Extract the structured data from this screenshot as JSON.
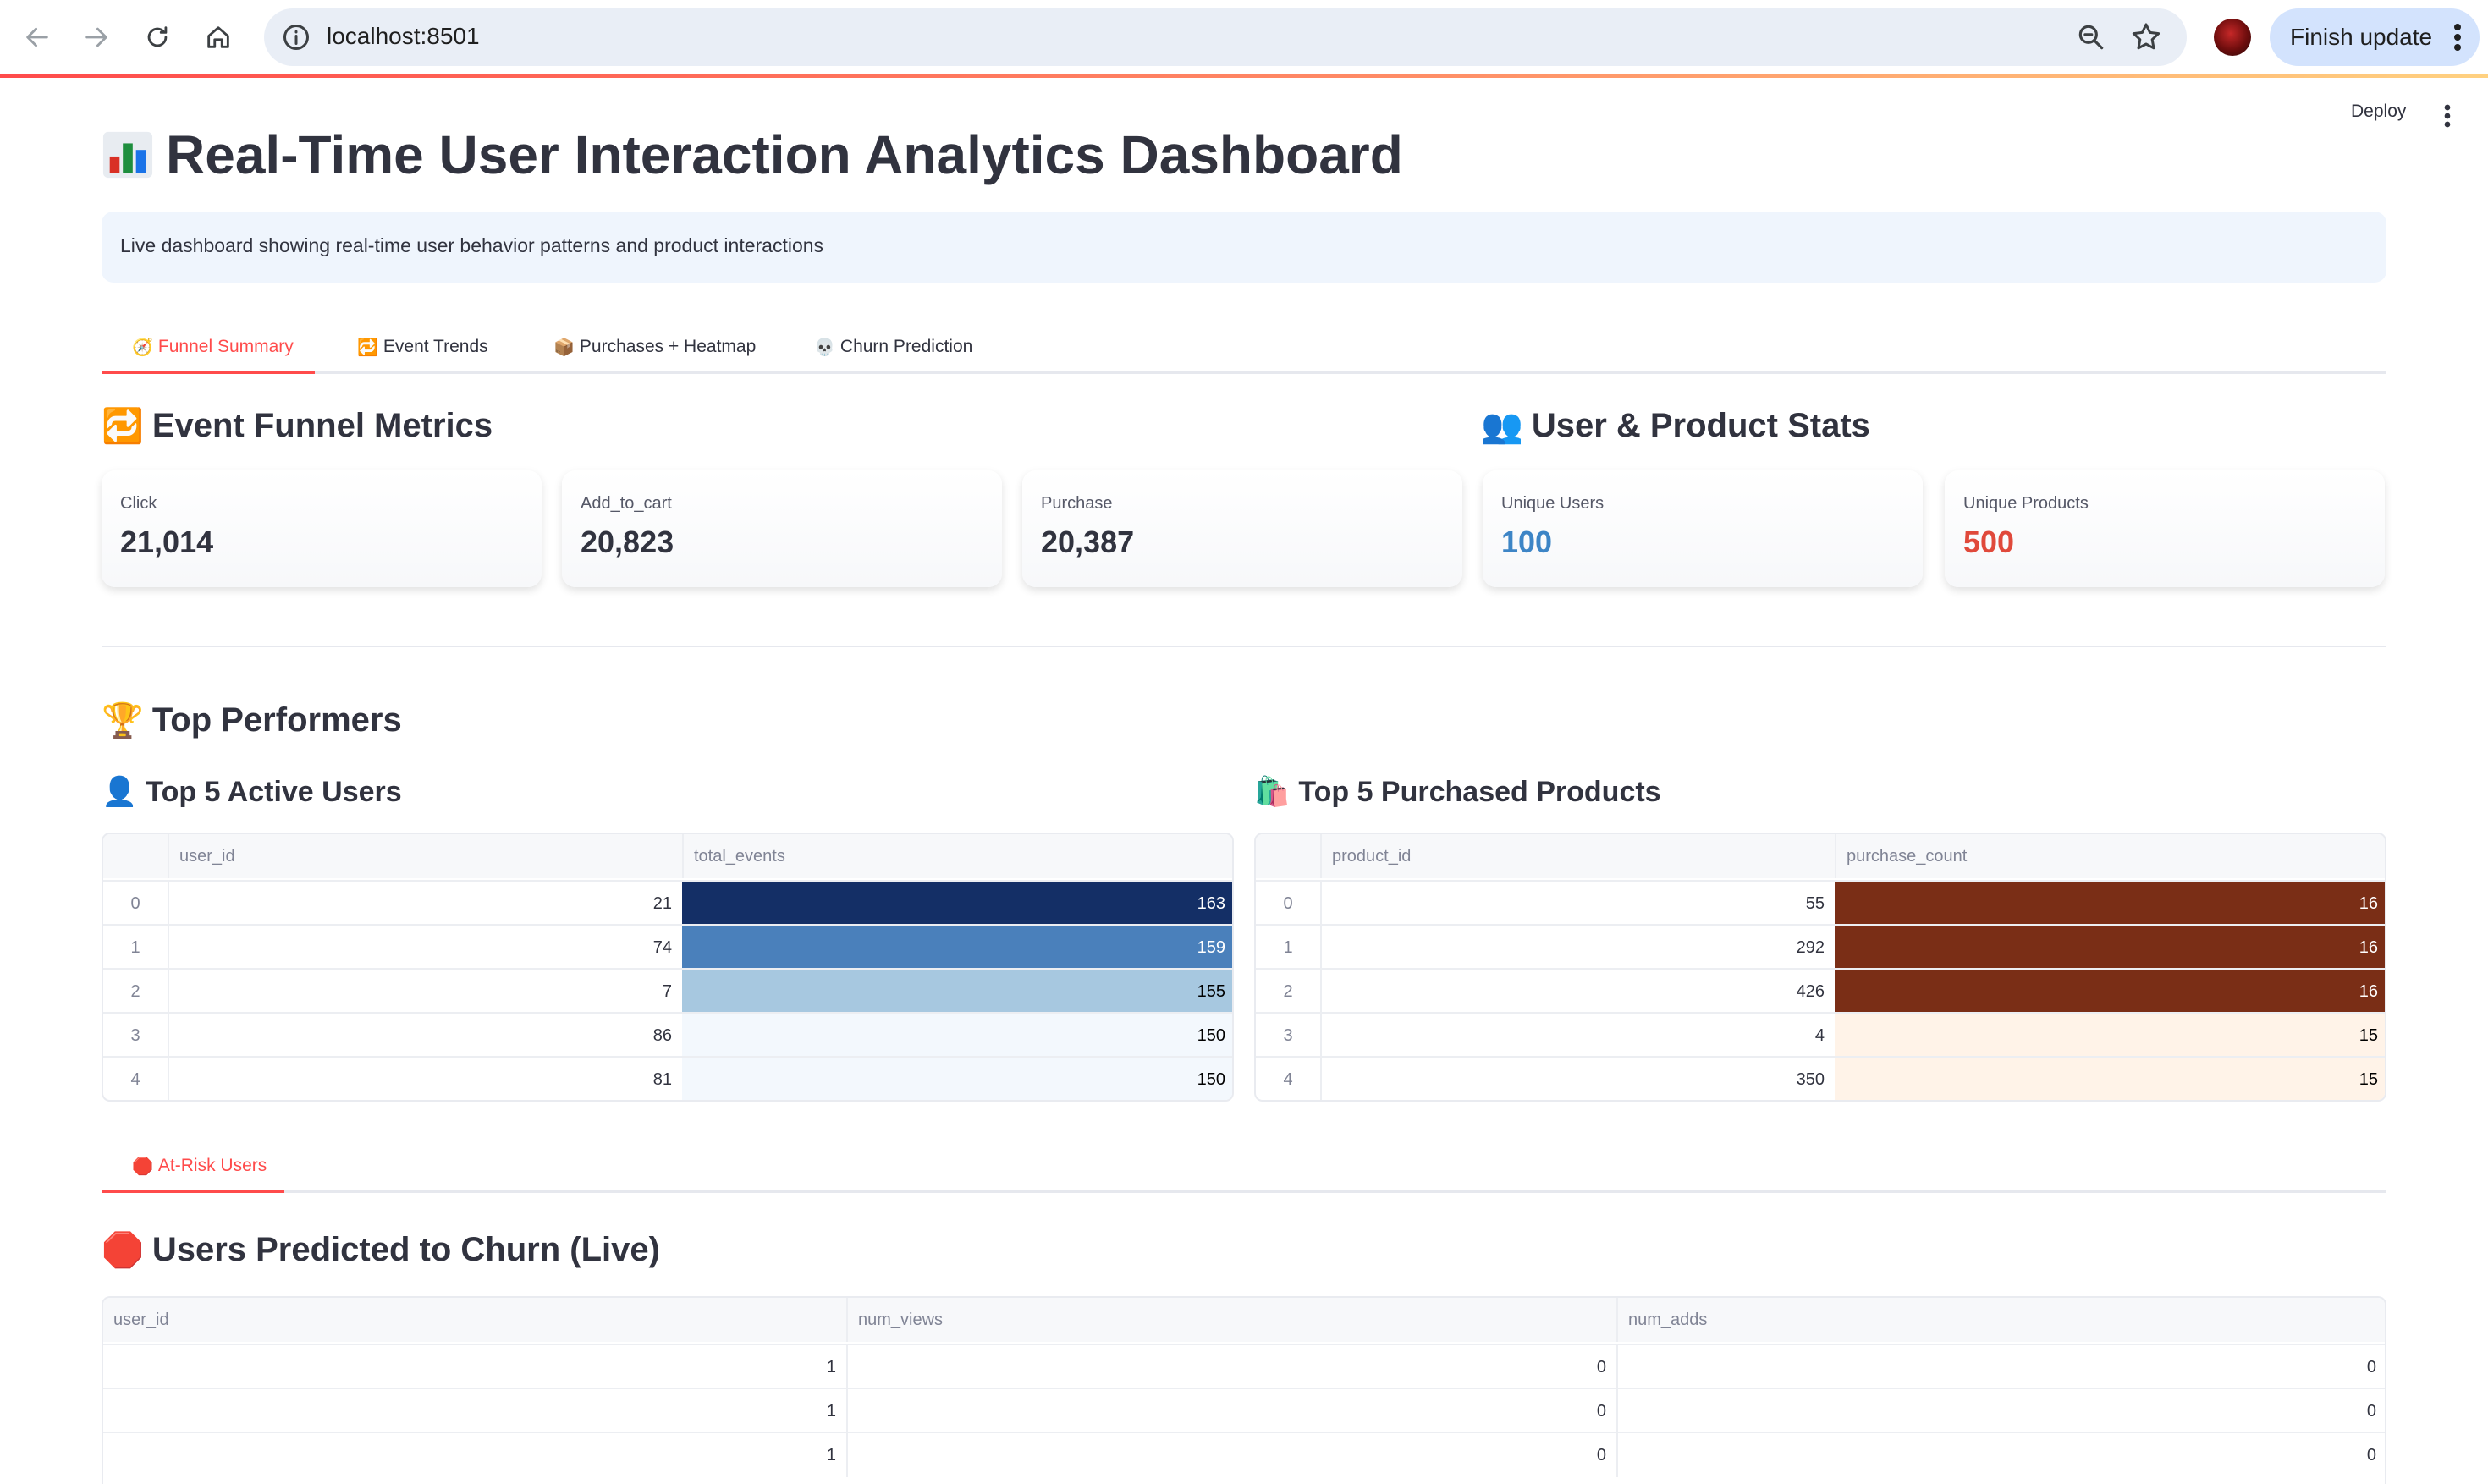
{
  "browser": {
    "url": "localhost:8501",
    "finish_update_label": "Finish update"
  },
  "header": {
    "deploy_label": "Deploy"
  },
  "page": {
    "title": "Real-Time User Interaction Analytics Dashboard",
    "info": "Live dashboard showing real-time user behavior patterns and product interactions"
  },
  "tabs": [
    {
      "label": "Funnel Summary",
      "icon": "compass-icon",
      "active": true
    },
    {
      "label": "Event Trends",
      "icon": "repeat-icon",
      "active": false
    },
    {
      "label": "Purchases + Heatmap",
      "icon": "package-icon",
      "active": false
    },
    {
      "label": "Churn Prediction",
      "icon": "skull-icon",
      "active": false
    }
  ],
  "funnel": {
    "heading": "Event Funnel Metrics",
    "metrics": [
      {
        "label": "Click",
        "value": "21,014"
      },
      {
        "label": "Add_to_cart",
        "value": "20,823"
      },
      {
        "label": "Purchase",
        "value": "20,387"
      }
    ]
  },
  "stats": {
    "heading": "User & Product Stats",
    "metrics": [
      {
        "label": "Unique Users",
        "value": "100",
        "color": "#3d85c6"
      },
      {
        "label": "Unique Products",
        "value": "500",
        "color": "#e0493b"
      }
    ]
  },
  "top_performers": {
    "heading": "Top Performers",
    "users": {
      "heading": "Top 5 Active Users",
      "columns": [
        "",
        "user_id",
        "total_events"
      ],
      "rows": [
        [
          "0",
          "21",
          "163"
        ],
        [
          "1",
          "74",
          "159"
        ],
        [
          "2",
          "7",
          "155"
        ],
        [
          "3",
          "86",
          "150"
        ],
        [
          "4",
          "81",
          "150"
        ]
      ],
      "cell_colors": [
        "#142f66",
        "#4a80bb",
        "#a7c8e0",
        "#f3f8fd",
        "#f3f8fd"
      ],
      "cell_text_colors": [
        "#ffffff",
        "#ffffff",
        "#000000",
        "#000000",
        "#000000"
      ]
    },
    "products": {
      "heading": "Top 5 Purchased Products",
      "columns": [
        "",
        "product_id",
        "purchase_count"
      ],
      "rows": [
        [
          "0",
          "55",
          "16"
        ],
        [
          "1",
          "292",
          "16"
        ],
        [
          "2",
          "426",
          "16"
        ],
        [
          "3",
          "4",
          "15"
        ],
        [
          "4",
          "350",
          "15"
        ]
      ],
      "cell_colors": [
        "#7a2e16",
        "#7a2e16",
        "#7a2e16",
        "#fff3e8",
        "#fff3e8"
      ],
      "cell_text_colors": [
        "#ffffff",
        "#ffffff",
        "#ffffff",
        "#000000",
        "#000000"
      ]
    }
  },
  "churn_tab": {
    "label": "At-Risk Users"
  },
  "churn": {
    "heading": "Users Predicted to Churn (Live)",
    "columns": [
      "user_id",
      "num_views",
      "num_adds"
    ],
    "rows": [
      [
        "1",
        "0",
        "0"
      ],
      [
        "1",
        "0",
        "0"
      ],
      [
        "1",
        "0",
        "0"
      ]
    ]
  }
}
